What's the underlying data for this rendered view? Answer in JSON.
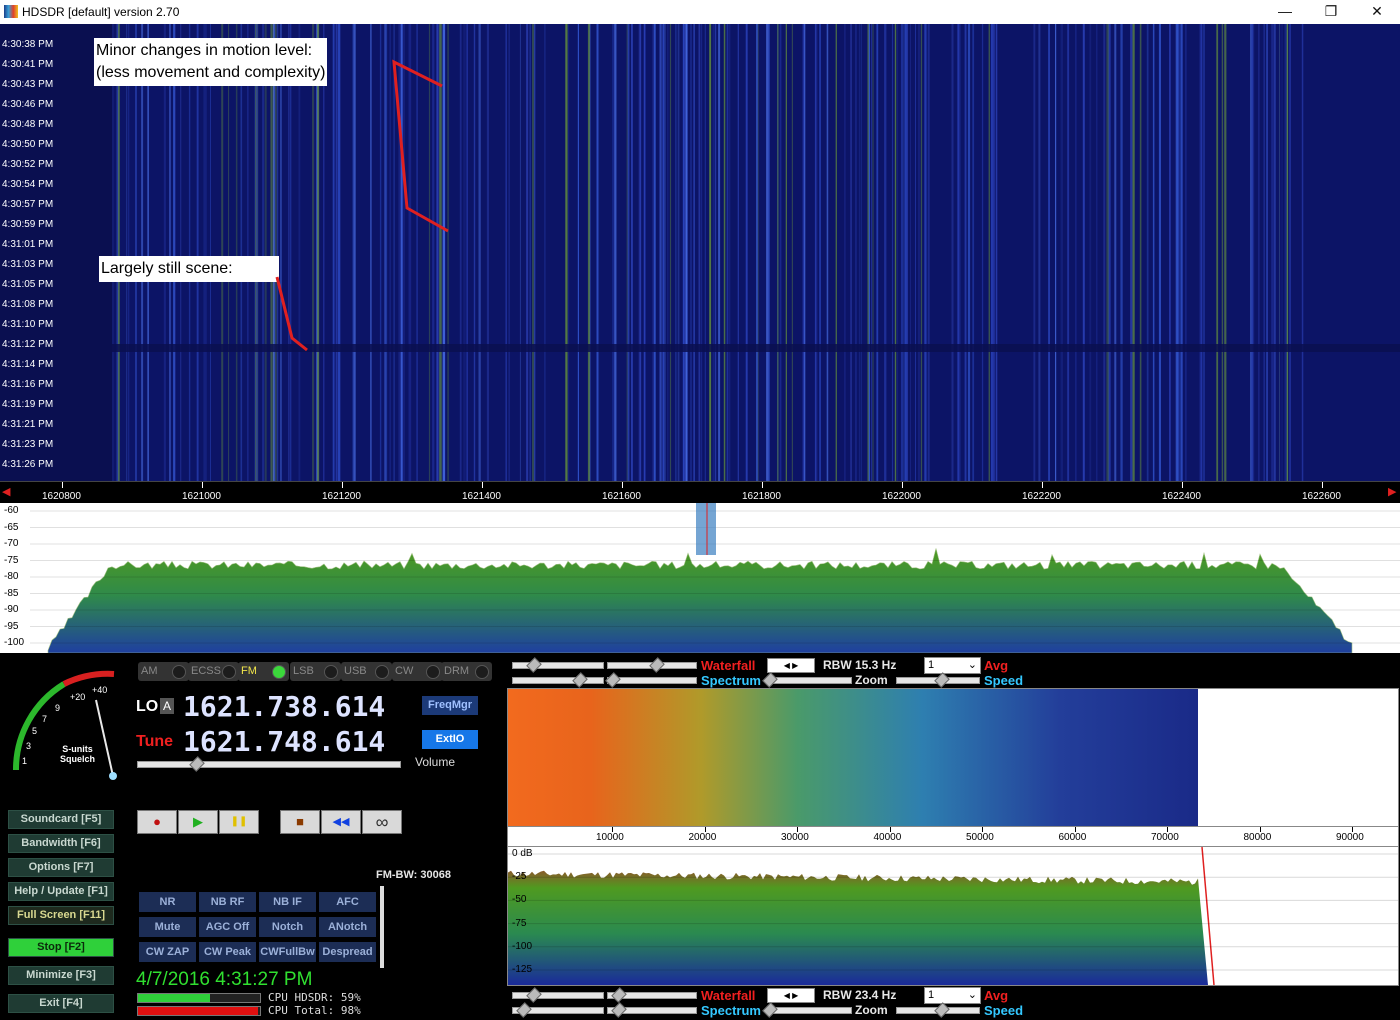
{
  "window": {
    "title": "HDSDR [default]  version 2.70",
    "minimize_glyph": "—",
    "restore_glyph": "❐",
    "close_glyph": "✕"
  },
  "waterfall": {
    "time_labels": [
      "4:30:38 PM",
      "4:30:41 PM",
      "4:30:43 PM",
      "4:30:46 PM",
      "4:30:48 PM",
      "4:30:50 PM",
      "4:30:52 PM",
      "4:30:54 PM",
      "4:30:57 PM",
      "4:30:59 PM",
      "4:31:01 PM",
      "4:31:03 PM",
      "4:31:05 PM",
      "4:31:08 PM",
      "4:31:10 PM",
      "4:31:12 PM",
      "4:31:14 PM",
      "4:31:16 PM",
      "4:31:19 PM",
      "4:31:21 PM",
      "4:31:23 PM",
      "4:31:26 PM"
    ],
    "annotation_1_line1": "Minor changes in motion level:",
    "annotation_1_line2": "(less movement and complexity)",
    "annotation_2": "Largely still scene:",
    "annotation_color": "#e02020"
  },
  "freq_ruler": {
    "labels": [
      "1620800",
      "1621000",
      "1621200",
      "1621400",
      "1621600",
      "1621800",
      "1622000",
      "1622200",
      "1622400",
      "1622600"
    ]
  },
  "spectrum": {
    "db_labels": [
      "-60",
      "-65",
      "-70",
      "-75",
      "-80",
      "-85",
      "-90",
      "-95",
      "-100"
    ]
  },
  "smeter": {
    "scale_labels": [
      "1",
      "3",
      "5",
      "7",
      "9",
      "+20",
      "+40"
    ],
    "caption_line1": "S-units",
    "caption_line2": "Squelch"
  },
  "modes": {
    "items": [
      "AM",
      "ECSS",
      "FM",
      "LSB",
      "USB",
      "CW",
      "DRM"
    ],
    "active": "FM"
  },
  "frequency": {
    "lo_label": "LO",
    "lo_ab": "A",
    "lo_value": "1621.738.614",
    "tune_label": "Tune",
    "tune_value": "1621.748.614",
    "freqmgr": "FreqMgr",
    "extio": "ExtIO",
    "volume_label": "Volume"
  },
  "side_buttons": [
    {
      "label": "Soundcard  [F5]"
    },
    {
      "label": "Bandwidth  [F6]"
    },
    {
      "label": "Options   [F7]"
    },
    {
      "label": "Help / Update  [F1]"
    },
    {
      "label": "Full Screen  [F11]"
    },
    {
      "label": "Stop        [F2]"
    },
    {
      "label": "Minimize  [F3]"
    },
    {
      "label": "Exit       [F4]"
    }
  ],
  "transport": {
    "record_glyph": "●",
    "play_glyph": "▶",
    "pause_glyph": "❚❚",
    "stop_glyph": "■",
    "rewind_glyph": "◀◀",
    "loop_glyph": "∞"
  },
  "fm_bw": "FM-BW: 30068",
  "func_buttons": [
    "NR",
    "NB RF",
    "NB IF",
    "AFC",
    "Mute",
    "AGC Off",
    "Notch",
    "ANotch",
    "CW ZAP",
    "CW Peak",
    "CWFullBw",
    "Despread"
  ],
  "status": {
    "datetime": "4/7/2016 4:31:27 PM",
    "cpu_hdsdr": "CPU HDSDR: 59%",
    "cpu_total": "CPU Total: 98%",
    "cpu_hdsdr_value": 59,
    "cpu_total_value": 98
  },
  "af_controls_top": {
    "waterfall": "Waterfall",
    "rbw": "RBW 15.3 Hz",
    "avg_value": "1",
    "avg": "Avg",
    "spectrum": "Spectrum",
    "zoom": "Zoom",
    "speed": "Speed"
  },
  "af_ruler": {
    "labels": [
      "10000",
      "20000",
      "30000",
      "40000",
      "50000",
      "60000",
      "70000",
      "80000",
      "90000"
    ]
  },
  "af_spectrum": {
    "db_labels": [
      "0 dB",
      "-25",
      "-50",
      "-75",
      "-100",
      "-125"
    ]
  },
  "af_controls_bottom": {
    "waterfall": "Waterfall",
    "rbw": "RBW 23.4 Hz",
    "avg_value": "1",
    "avg": "Avg",
    "spectrum": "Spectrum",
    "zoom": "Zoom",
    "speed": "Speed"
  },
  "colors": {
    "waterfall_bg": "#0c1466",
    "spectrum_green": "#3c9a2a",
    "freq_display": "#dde3ff",
    "tune_label": "#f02020",
    "datetime": "#30e030"
  }
}
